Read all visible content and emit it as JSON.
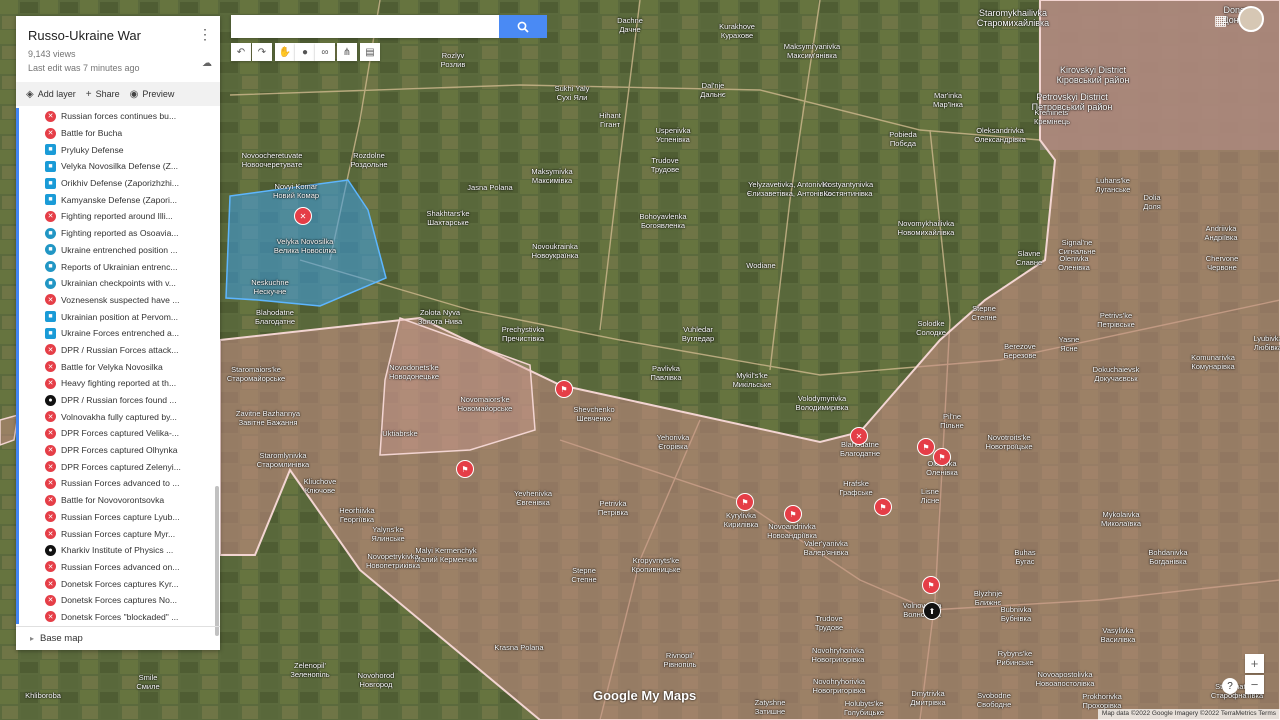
{
  "map_title": "Russo-Ukraine War",
  "views": "9,143 views",
  "last_edit": "Last edit was 7 minutes ago",
  "actions": {
    "add_layer": "Add layer",
    "share": "Share",
    "preview": "Preview"
  },
  "layers": [
    {
      "icon": "red",
      "label": "Russian forces continues bu..."
    },
    {
      "icon": "red",
      "label": "Battle for Bucha"
    },
    {
      "icon": "blue",
      "label": "Pryluky Defense"
    },
    {
      "icon": "blue",
      "label": "Velyka Novosilka Defense (Z..."
    },
    {
      "icon": "blue",
      "label": "Orikhiv Defense (Zaporizhzhi..."
    },
    {
      "icon": "blue",
      "label": "Kamyanske Defense (Zapori..."
    },
    {
      "icon": "red",
      "label": "Fighting reported around Illi..."
    },
    {
      "icon": "teal",
      "label": "Fighting reported as Osoavia..."
    },
    {
      "icon": "teal",
      "label": "Ukraine entrenched position ..."
    },
    {
      "icon": "teal",
      "label": "Reports of Ukrainian entrenc..."
    },
    {
      "icon": "teal",
      "label": "Ukrainian checkpoints with v..."
    },
    {
      "icon": "red",
      "label": "Voznesensk suspected have ..."
    },
    {
      "icon": "blue",
      "label": "Ukrainian position at Pervom..."
    },
    {
      "icon": "blue",
      "label": "Ukraine Forces entrenched a..."
    },
    {
      "icon": "red",
      "label": "DPR / Russian Forces attack..."
    },
    {
      "icon": "red",
      "label": "Battle for Velyka Novosilka"
    },
    {
      "icon": "red",
      "label": "Heavy fighting reported at th..."
    },
    {
      "icon": "black",
      "label": "DPR / Russian forces found ..."
    },
    {
      "icon": "red",
      "label": "Volnovakha fully captured by..."
    },
    {
      "icon": "red",
      "label": "DPR Forces captured Velika-..."
    },
    {
      "icon": "red",
      "label": "DPR Forces captured Olhynka"
    },
    {
      "icon": "red",
      "label": "DPR Forces captured Zelenyi..."
    },
    {
      "icon": "red",
      "label": "Russian Forces advanced to ..."
    },
    {
      "icon": "red",
      "label": "Battle for Novovorontsovka"
    },
    {
      "icon": "red",
      "label": "Russian Forces capture Lyub..."
    },
    {
      "icon": "red",
      "label": "Russian Forces capture Myr..."
    },
    {
      "icon": "black",
      "label": "Kharkiv Institute of Physics ..."
    },
    {
      "icon": "red",
      "label": "Russian Forces advanced on..."
    },
    {
      "icon": "red",
      "label": "Donetsk Forces captures Kyr..."
    },
    {
      "icon": "red",
      "label": "Donetsk Forces captures No..."
    },
    {
      "icon": "red",
      "label": "Donetsk Forces \"blockaded\" ..."
    }
  ],
  "base_map": "Base map",
  "search": {
    "value": "",
    "placeholder": ""
  },
  "place_labels": [
    {
      "t": "Dachne",
      "t2": "Дачне"
    },
    {
      "t": "Kurakhove",
      "t2": "Курахове"
    },
    {
      "t": "Maksymi'yanivka",
      "t2": "Максим'янівка"
    },
    {
      "t": "Rozlyv",
      "t2": "Розлив"
    },
    {
      "t": "Sukhi Yaly",
      "t2": "Сухі Яли"
    },
    {
      "t": "Dal'nje",
      "t2": "Дальнє"
    },
    {
      "t": "Hihant",
      "t2": "Гігант"
    },
    {
      "t": "Uspenivka",
      "t2": "Успенівка"
    },
    {
      "t": "Pobieda",
      "t2": "Побєда"
    },
    {
      "t": "Mar'inka",
      "t2": "Мар'їнка"
    },
    {
      "t": "Oleksandrivka",
      "t2": "Олександрівка"
    },
    {
      "t": "Novoocheretuvate",
      "t2": "Новоочеретувате"
    },
    {
      "t": "Rozdolne",
      "t2": "Роздольне"
    },
    {
      "t": "Maksymivka",
      "t2": "Максимівка"
    },
    {
      "t": "Trudove",
      "t2": "Трудове"
    },
    {
      "t": "Yelyzavetivka, Antonivka",
      "t2": "Єлизаветівка, Антонівка"
    },
    {
      "t": "Novyi Komar",
      "t2": "Новий Комар"
    },
    {
      "t": "Jasna Polana",
      "t2": ""
    },
    {
      "t": "Kostyantynivka",
      "t2": "Костянтинівка"
    },
    {
      "t": "Shakhtars'ke",
      "t2": "Шахтарське"
    },
    {
      "t": "Bohoyavlenka",
      "t2": "Богоявленка"
    },
    {
      "t": "Novomykhailivka",
      "t2": "Новомихайлівка"
    },
    {
      "t": "Velyka Novosilka",
      "t2": "Велика Новосілка"
    },
    {
      "t": "Novoukrainka",
      "t2": "Новоукраїнка"
    },
    {
      "t": "Wodiane",
      "t2": ""
    },
    {
      "t": "Slavne",
      "t2": "Славне"
    },
    {
      "t": "Neskuchne",
      "t2": "Нескучне"
    },
    {
      "t": "Blahodatne",
      "t2": "Благодатне"
    },
    {
      "t": "Zolota Nyva",
      "t2": "Золота Нива"
    },
    {
      "t": "Prechystivka",
      "t2": "Пречистівка"
    },
    {
      "t": "Vuhledar",
      "t2": "Вугледар"
    },
    {
      "t": "Stepne",
      "t2": "Степне"
    },
    {
      "t": "Solodke",
      "t2": "Солодке"
    },
    {
      "t": "Pavlivka",
      "t2": "Павлівка"
    },
    {
      "t": "Mykil's'ke",
      "t2": "Микільське"
    },
    {
      "t": "Novodonets'ke",
      "t2": "Новодонецьке"
    },
    {
      "t": "Staromaiors'ke",
      "t2": "Старомайорське"
    },
    {
      "t": "Novomaiors'ke",
      "t2": "Новомайорське"
    },
    {
      "t": "Volodymyrivka",
      "t2": "Володимирівка"
    },
    {
      "t": "Berezove",
      "t2": "Березове"
    },
    {
      "t": "Shevchenko",
      "t2": "Шевченко"
    },
    {
      "t": "Zavitne Bazhannya",
      "t2": "Завітне Бажання"
    },
    {
      "t": "Pil'ne",
      "t2": "Пільне"
    },
    {
      "t": "Yehorivka",
      "t2": "Єгорівка"
    },
    {
      "t": "Blahodatne",
      "t2": "Благодатне"
    },
    {
      "t": "Novotroits'ke",
      "t2": "Новотроїцьке"
    },
    {
      "t": "Uktiabrske",
      "t2": ""
    },
    {
      "t": "Olenivka",
      "t2": "Оленівка"
    },
    {
      "t": "Staromlynivka",
      "t2": "Старомлинівка"
    },
    {
      "t": "Hrafske",
      "t2": "Графське"
    },
    {
      "t": "Kliuchove",
      "t2": "Ключове"
    },
    {
      "t": "Yevhenivka",
      "t2": "Євгенівка"
    },
    {
      "t": "Lisne",
      "t2": "Лісне"
    },
    {
      "t": "Petrivka",
      "t2": "Петрівка"
    },
    {
      "t": "Kyrylivka",
      "t2": "Кирилівка"
    },
    {
      "t": "Novoandriivka",
      "t2": "Новоандріївка"
    },
    {
      "t": "Heorhiivka",
      "t2": "Георгіївка"
    },
    {
      "t": "Yalyns'ke",
      "t2": "Ялинське"
    },
    {
      "t": "Valer'yanivka",
      "t2": "Валер'янівка"
    },
    {
      "t": "Malyi Kermenchyk",
      "t2": "Малий Керменчик"
    },
    {
      "t": "Novopetrykivka",
      "t2": "Новопетриківка"
    },
    {
      "t": "Kropyvnyts'ke",
      "t2": "Кропивницьке"
    },
    {
      "t": "Stepne",
      "t2": "Степне"
    },
    {
      "t": "Volnovakha",
      "t2": "Волноваха"
    },
    {
      "t": "Blyzhnje",
      "t2": "Ближнє"
    },
    {
      "t": "Trudove",
      "t2": "Трудове"
    },
    {
      "t": "Bubnivka",
      "t2": "Бубнівка"
    },
    {
      "t": "Novohryhorivka",
      "t2": "Новогригорівка"
    },
    {
      "t": "Rybyns'ke",
      "t2": "Рибинське"
    },
    {
      "t": "Zelenopil'",
      "t2": "Зеленопіль"
    },
    {
      "t": "Novohryhorivka",
      "t2": "Новогригорівка"
    },
    {
      "t": "Rivnopil'",
      "t2": "Рівнопіль"
    },
    {
      "t": "Krasna Polana",
      "t2": ""
    },
    {
      "t": "Novohorod",
      "t2": "Новгород"
    },
    {
      "t": "Holubyts'ke",
      "t2": "Голубицьке"
    },
    {
      "t": "Dmytrivka",
      "t2": "Дмитрівка"
    },
    {
      "t": "Svobodne",
      "t2": "Свободне"
    },
    {
      "t": "Zatyshne",
      "t2": "Затишне"
    },
    {
      "t": "Smile",
      "t2": "Смиле"
    },
    {
      "t": "Khliboroba",
      "t2": ""
    },
    {
      "t": "Novoapostolivka",
      "t2": "Новоапостолівка"
    },
    {
      "t": "Starofnativka",
      "t2": "Старофнатівка"
    },
    {
      "t": "Prokhorivka",
      "t2": "Прохорівка"
    },
    {
      "t": "Vasylivka",
      "t2": "Василівка"
    },
    {
      "t": "Bohdanivka",
      "t2": "Богданівка"
    },
    {
      "t": "Mykolaivka",
      "t2": "Миколаївка"
    },
    {
      "t": "Buhas",
      "t2": "Бугас"
    },
    {
      "t": "Komunarivka",
      "t2": "Комунарівка"
    },
    {
      "t": "Dokuchaievsk",
      "t2": "Докучаєвськ"
    },
    {
      "t": "Yasne",
      "t2": "Ясне"
    },
    {
      "t": "Lyubivka",
      "t2": "Любівка"
    },
    {
      "t": "Petrivs'ke",
      "t2": "Петрівське"
    },
    {
      "t": "Olenivka",
      "t2": "Оленівка"
    },
    {
      "t": "Signal'ne",
      "t2": "Сигнальне"
    },
    {
      "t": "Chervone",
      "t2": "Червоне"
    },
    {
      "t": "Andriivka",
      "t2": "Андріївка"
    },
    {
      "t": "Dolia",
      "t2": "Доля"
    },
    {
      "t": "Luhans'ke",
      "t2": "Луганське"
    },
    {
      "t": "Kreminets'",
      "t2": "Кремінець"
    },
    {
      "t": "Donetsk",
      "t2": "Донецьк"
    },
    {
      "t": "Kirovskyi District",
      "t2": "Кіровський район"
    },
    {
      "t": "Petrovskyi District",
      "t2": "Петровський район"
    },
    {
      "t": "Staromykhailivka",
      "t2": "Старомихайлівка"
    }
  ],
  "logo": "Google My Maps",
  "attribution": "Map data ©2022 Google Imagery ©2022 TerraMetrics   Terms",
  "zoom_in": "+",
  "zoom_out": "−",
  "help": "?"
}
